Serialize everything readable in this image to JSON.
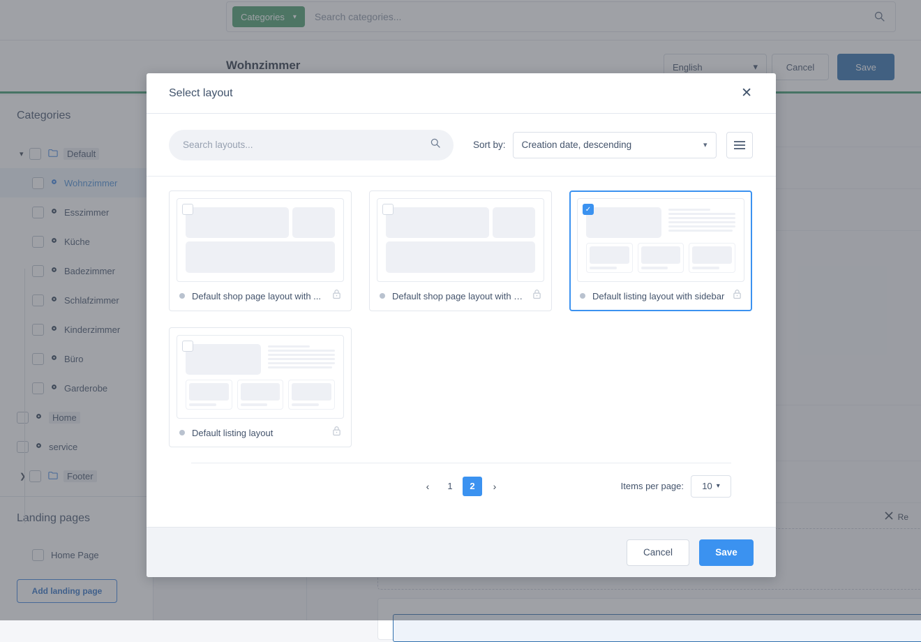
{
  "app": {
    "topbar": {
      "categories_button": "Categories",
      "search_placeholder": "Search categories...",
      "search_icon": "search-icon",
      "chevron_icon": "chevron-down-icon"
    },
    "pagehead": {
      "title": "Wohnzimmer",
      "language": "English",
      "cancel_label": "Cancel",
      "save_label": "Save"
    },
    "sidebar": {
      "title": "Categories",
      "tree": [
        {
          "label": "Default",
          "level": 0,
          "icon": "folder-icon",
          "caret": "chevron-down-icon",
          "chip": true,
          "selected": false
        },
        {
          "label": "Wohnzimmer",
          "level": 1,
          "icon": "dot-icon",
          "caret": "",
          "chip": false,
          "selected": true
        },
        {
          "label": "Esszimmer",
          "level": 1,
          "icon": "dot-icon",
          "caret": "",
          "chip": false,
          "selected": false
        },
        {
          "label": "Küche",
          "level": 1,
          "icon": "dot-icon",
          "caret": "",
          "chip": false,
          "selected": false
        },
        {
          "label": "Badezimmer",
          "level": 1,
          "icon": "dot-icon",
          "caret": "",
          "chip": false,
          "selected": false
        },
        {
          "label": "Schlafzimmer",
          "level": 1,
          "icon": "dot-icon",
          "caret": "",
          "chip": false,
          "selected": false
        },
        {
          "label": "Kinderzimmer",
          "level": 1,
          "icon": "dot-icon",
          "caret": "",
          "chip": false,
          "selected": false
        },
        {
          "label": "Büro",
          "level": 1,
          "icon": "dot-icon",
          "caret": "",
          "chip": false,
          "selected": false
        },
        {
          "label": "Garderobe",
          "level": 1,
          "icon": "dot-icon",
          "caret": "",
          "chip": false,
          "selected": false
        },
        {
          "label": "Home",
          "level": 0,
          "icon": "dot-icon",
          "caret": "",
          "chip": true,
          "selected": false
        },
        {
          "label": "service",
          "level": 0,
          "icon": "dot-icon",
          "caret": "",
          "chip": false,
          "selected": false
        },
        {
          "label": "Footer",
          "level": 0,
          "icon": "folder-icon",
          "caret": "chevron-right-icon",
          "chip": true,
          "selected": false
        }
      ],
      "landing_title": "Landing pages",
      "landing_items": [
        "Home Page"
      ],
      "add_landing_label": "Add landing page"
    },
    "content": {
      "remove_label": "Re"
    }
  },
  "modal": {
    "title": "Select layout",
    "close_icon": "close-icon",
    "toolbar": {
      "search_placeholder": "Search layouts...",
      "search_value": "",
      "search_icon": "search-icon",
      "sort_by_label": "Sort by:",
      "sort_value": "Creation date, descending",
      "sort_options": [
        "Creation date, descending"
      ],
      "chevron_icon": "chevron-down-icon",
      "view_toggle_icon": "list-view-icon"
    },
    "cards": [
      {
        "name": "Default shop page layout with ...",
        "preview": "shop",
        "selected": false,
        "locked": true,
        "status_dot": "#b9c2cf",
        "lock_icon": "lock-icon"
      },
      {
        "name": "Default shop page layout with c...",
        "preview": "shop",
        "selected": false,
        "locked": true,
        "status_dot": "#b9c2cf",
        "lock_icon": "lock-icon"
      },
      {
        "name": "Default listing layout with sidebar",
        "preview": "listing",
        "selected": true,
        "locked": true,
        "status_dot": "#b9c2cf",
        "lock_icon": "lock-icon"
      },
      {
        "name": "Default listing layout",
        "preview": "listing",
        "selected": false,
        "locked": true,
        "status_dot": "#b9c2cf",
        "lock_icon": "lock-icon"
      }
    ],
    "pagination": {
      "prev_icon": "chevron-left-icon",
      "next_icon": "chevron-right-icon",
      "pages": [
        "1",
        "2"
      ],
      "active_page": "2",
      "items_per_page_label": "Items per page:",
      "items_per_page_value": "10"
    },
    "footer": {
      "cancel_label": "Cancel",
      "save_label": "Save"
    }
  },
  "colors": {
    "accent_blue": "#3b92f0",
    "brand_green": "#3d9a6d",
    "top_save_blue": "#2f6fad"
  }
}
